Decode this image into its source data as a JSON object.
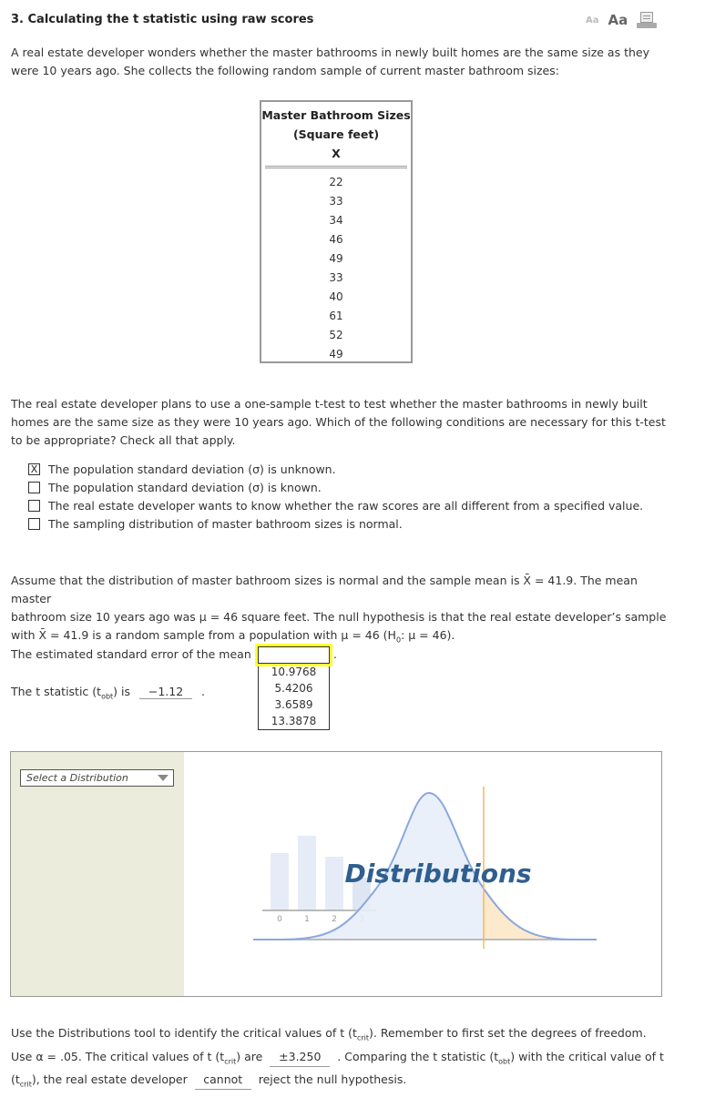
{
  "header": {
    "title": "3. Calculating the t statistic using raw scores",
    "font_small_label": "Aa",
    "font_large_label": "Aa",
    "print_icon": "printer-icon"
  },
  "intro": "A real estate developer wonders whether the master bathrooms in newly built homes are the same size as they were 10 years ago. She collects the following random sample of current master bathroom sizes:",
  "table": {
    "header_line1": "Master Bathroom Sizes",
    "header_line2": "(Square feet)",
    "header_line3": "X",
    "values": [
      "22",
      "33",
      "34",
      "46",
      "49",
      "33",
      "40",
      "61",
      "52",
      "49"
    ]
  },
  "question2": "The real estate developer plans to use a one-sample t-test to test whether the master bathrooms in newly built homes are the same size as they were 10 years ago. Which of the following conditions are necessary for this t-test to be appropriate? Check all that apply.",
  "options": [
    {
      "label": "The population standard deviation (σ) is unknown.",
      "checked": true,
      "mark": "X"
    },
    {
      "label": "The population standard deviation (σ) is known.",
      "checked": false,
      "mark": ""
    },
    {
      "label": "The real estate developer wants to know whether the raw scores are all different from a specified value.",
      "checked": false,
      "mark": ""
    },
    {
      "label": "The sampling distribution of master bathroom sizes is normal.",
      "checked": false,
      "mark": ""
    }
  ],
  "assume": {
    "line1": "Assume that the distribution of master bathroom sizes is normal and the sample mean is X̄ = 41.9. The mean master",
    "line2": "bathroom size 10 years ago was μ = 46 square feet. The null hypothesis is that the real estate developer’s sample",
    "line3_a": "with X̄ = 41.9 is a random sample from a population with μ = 46 (H",
    "line3_sub": "0",
    "line3_b": ": μ = 46)."
  },
  "se": {
    "label": "The estimated standard error of the mean is",
    "value": "",
    "period": ".",
    "options": [
      "10.9768",
      "5.4206",
      "3.6589",
      "13.3878"
    ]
  },
  "tstat": {
    "label_a": "The t statistic (t",
    "label_sub": "obt",
    "label_b": ") is",
    "value": "−1.12",
    "period": "."
  },
  "distributions": {
    "select_placeholder": "Select a Distribution",
    "logo_text": "Distributions",
    "bar_labels": [
      "0",
      "1",
      "2",
      "3"
    ],
    "colors": {
      "curve": "#8aa8e0",
      "fill": "#e8eef8",
      "tail": "#fde9cc",
      "crit_line": "#f5b860",
      "logo": "#2e5f8f",
      "side": "#ececdc"
    }
  },
  "final": {
    "line1_a": "Use the Distributions tool to identify the critical values of t (t",
    "line1_sub": "crit",
    "line1_b": "). Remember to first set the degrees of freedom.",
    "line2_a": "Use α = .05. The critical values of t (t",
    "line2_sub": "crit",
    "line2_b": ") are",
    "tcrit_value": "±3.250",
    "line2_c": ". Comparing the t statistic (t",
    "line2_sub2": "obt",
    "line2_d": ") with the critical value of t",
    "line3_a": "(t",
    "line3_sub": "crit",
    "line3_b": "), the real estate developer",
    "decision_value": "cannot",
    "line3_c": "reject the null hypothesis."
  }
}
